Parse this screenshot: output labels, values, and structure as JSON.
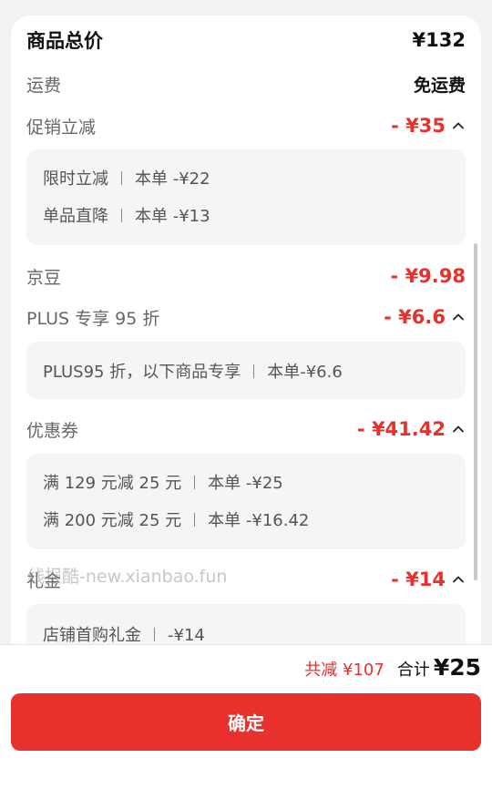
{
  "summary": {
    "title": "商品总价",
    "total": "¥132"
  },
  "shipping": {
    "label": "运费",
    "value": "免运费"
  },
  "promo": {
    "label": "促销立减",
    "value": "- ¥35",
    "details": [
      {
        "name": "限时立减",
        "amount": "本单 -¥22"
      },
      {
        "name": "单品直降",
        "amount": "本单 -¥13"
      }
    ]
  },
  "jingdou": {
    "label": "京豆",
    "value": "- ¥9.98"
  },
  "plus": {
    "label": "PLUS 专享 95 折",
    "value": "- ¥6.6",
    "details": [
      {
        "name": "PLUS95 折，以下商品专享",
        "amount": "本单-¥6.6"
      }
    ]
  },
  "coupon": {
    "label": "优惠券",
    "value": "- ¥41.42",
    "details": [
      {
        "name": "满 129 元减 25 元",
        "amount": "本单 -¥25"
      },
      {
        "name": "满 200 元减 25 元",
        "amount": "本单 -¥16.42"
      }
    ]
  },
  "gift": {
    "label": "礼金",
    "value": "- ¥14",
    "details": [
      {
        "name": "店铺首购礼金",
        "amount": "-¥14"
      }
    ]
  },
  "watermark": "线报酷-new.xianbao.fun",
  "footer": {
    "saved": "共减 ¥107",
    "sum_label": "合计",
    "sum_value": "¥25",
    "confirm": "确定"
  },
  "colors": {
    "accent_red": "#e5322d",
    "button_red": "#e8312d"
  },
  "icons": {
    "expand": "chevron-up-icon"
  }
}
